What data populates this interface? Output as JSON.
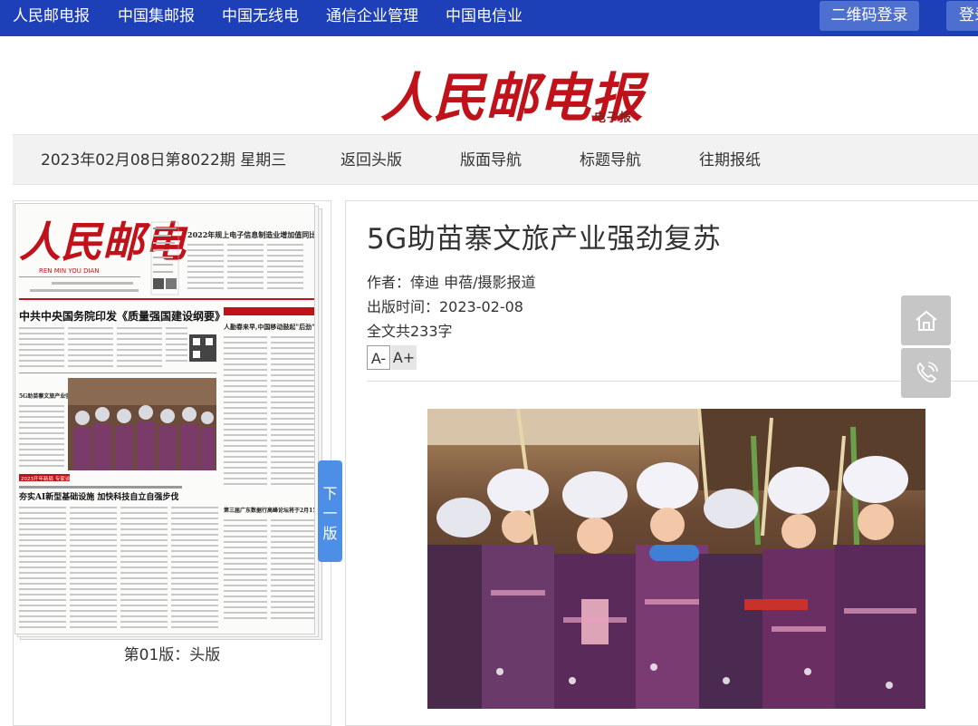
{
  "topnav": {
    "links": [
      "人民邮电报",
      "中国集邮报",
      "中国无线电",
      "通信企业管理",
      "中国电信业"
    ],
    "qr_login": "二维码登录",
    "login": "登录"
  },
  "masthead": {
    "logo_text": "人民邮电报",
    "subtitle": "电子报"
  },
  "subnav": {
    "issue": "2023年02月08日第8022期 星期三",
    "items": [
      "返回头版",
      "版面导航",
      "标题导航",
      "往期报纸"
    ]
  },
  "newspaper": {
    "nameplate": "人民邮电",
    "pinyin": "REN MIN YOU DIAN",
    "top_headline": "2022年规上电子信息制造业增加值同比增长7.6%",
    "headline": "中共中央国务院印发《质量强国建设纲要》",
    "side_headline": "人勤春来早,中国移动鼓起\"后劲\"",
    "photo_caption": "5G助苗寨文旅产业强劲复苏",
    "tag": "2023开年新局 专家谈",
    "sub_headline": "夯实AI新型基础设施 加快科技自立自强步伐",
    "right_headline": "第三届广东数据行高峰论坛将于2月15日至16日在厦门举办",
    "page_caption": "第01版：头版"
  },
  "next_tab": [
    "下",
    "一",
    "版"
  ],
  "article": {
    "title": "5G助苗寨文旅产业强劲复苏",
    "author": "作者：倖迪 申蓓/摄影报道",
    "publish_time": "出版时间：2023-02-08",
    "word_count": "全文共233字",
    "font_smaller": "A-",
    "font_larger": "A+"
  },
  "floating": {
    "home_icon": "home-icon",
    "phone_icon": "phone-icon"
  }
}
